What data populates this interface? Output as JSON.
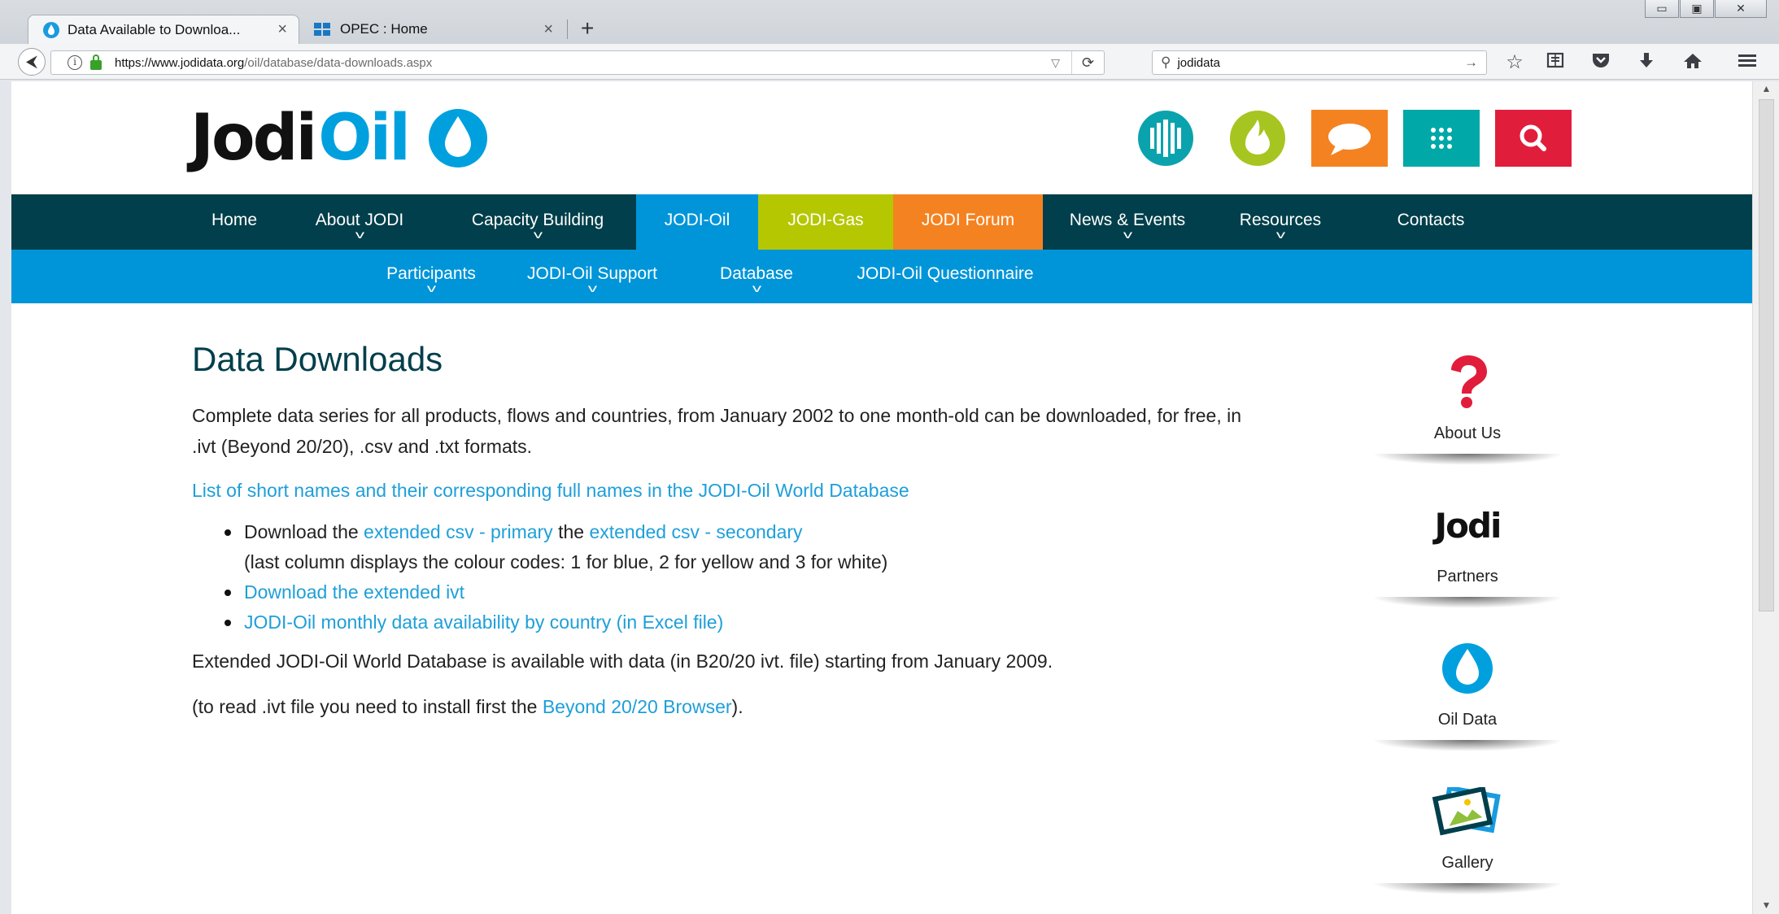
{
  "browser": {
    "tabs": [
      {
        "title": "Data Available to Downloa...",
        "close": "×"
      },
      {
        "title": "OPEC : Home",
        "close": "×"
      }
    ],
    "new_tab": "+",
    "window_buttons": [
      "▭",
      "▣",
      "✕"
    ],
    "url_domain": "https://www.jodidata.org",
    "url_path": "/oil/database/data-downloads.aspx",
    "search_value": "jodidata",
    "back": "⮜",
    "reload": "⟳",
    "url_dropdown": "▽",
    "search_go": "→",
    "search_mag": "⚲"
  },
  "site": {
    "logo_jodi": "Jodi",
    "logo_oil": "Oil",
    "main_nav": [
      "Home",
      "About JODI",
      "Capacity Building",
      "JODI-Oil",
      "JODI-Gas",
      "JODI Forum",
      "News & Events",
      "Resources",
      "Contacts"
    ],
    "sub_nav": [
      "Participants",
      "JODI-Oil Support",
      "Database",
      "JODI-Oil Questionnaire"
    ],
    "chevron": "v"
  },
  "content": {
    "title": "Data Downloads",
    "intro": "Complete data series for all products, flows and countries, from January 2002 to one month-old can be downloaded, for free, in .ivt (Beyond 20/20), .csv and .txt formats.",
    "short_names_link": "List of short names and their corresponding full names in the JODI-Oil World Database",
    "li1_prefix": "Download the ",
    "li1_link1": "extended csv - primary",
    "li1_mid": " the ",
    "li1_link2": "extended csv - secondary",
    "li1_note": "(last column displays the colour codes: 1 for blue, 2 for yellow and 3 for white)",
    "li2_link": "Download the extended ivt",
    "li3_link": "JODI-Oil monthly data availability by country (in Excel file)",
    "extended_text": "Extended JODI-Oil World Database is available with data (in B20/20 ivt. file) starting from January 2009.",
    "read_prefix": "(to read .ivt file you need to install first the ",
    "read_link": "Beyond 20/20 Browser",
    "read_suffix": ")."
  },
  "sidebar": {
    "about": "About Us",
    "partners_logo": "Jodi",
    "partners": "Partners",
    "oil_data": "Oil Data",
    "gallery": "Gallery"
  },
  "colors": {
    "nav_dark": "#003f4b",
    "nav_blue": "#0095d9",
    "jodi_gas": "#b5c700",
    "jodi_forum": "#f58220",
    "link": "#1e9fd9",
    "teal": "#0aa3ad",
    "lime": "#a7c520",
    "orange": "#f58220",
    "teal2": "#00a8a8",
    "red": "#e11d3c"
  }
}
